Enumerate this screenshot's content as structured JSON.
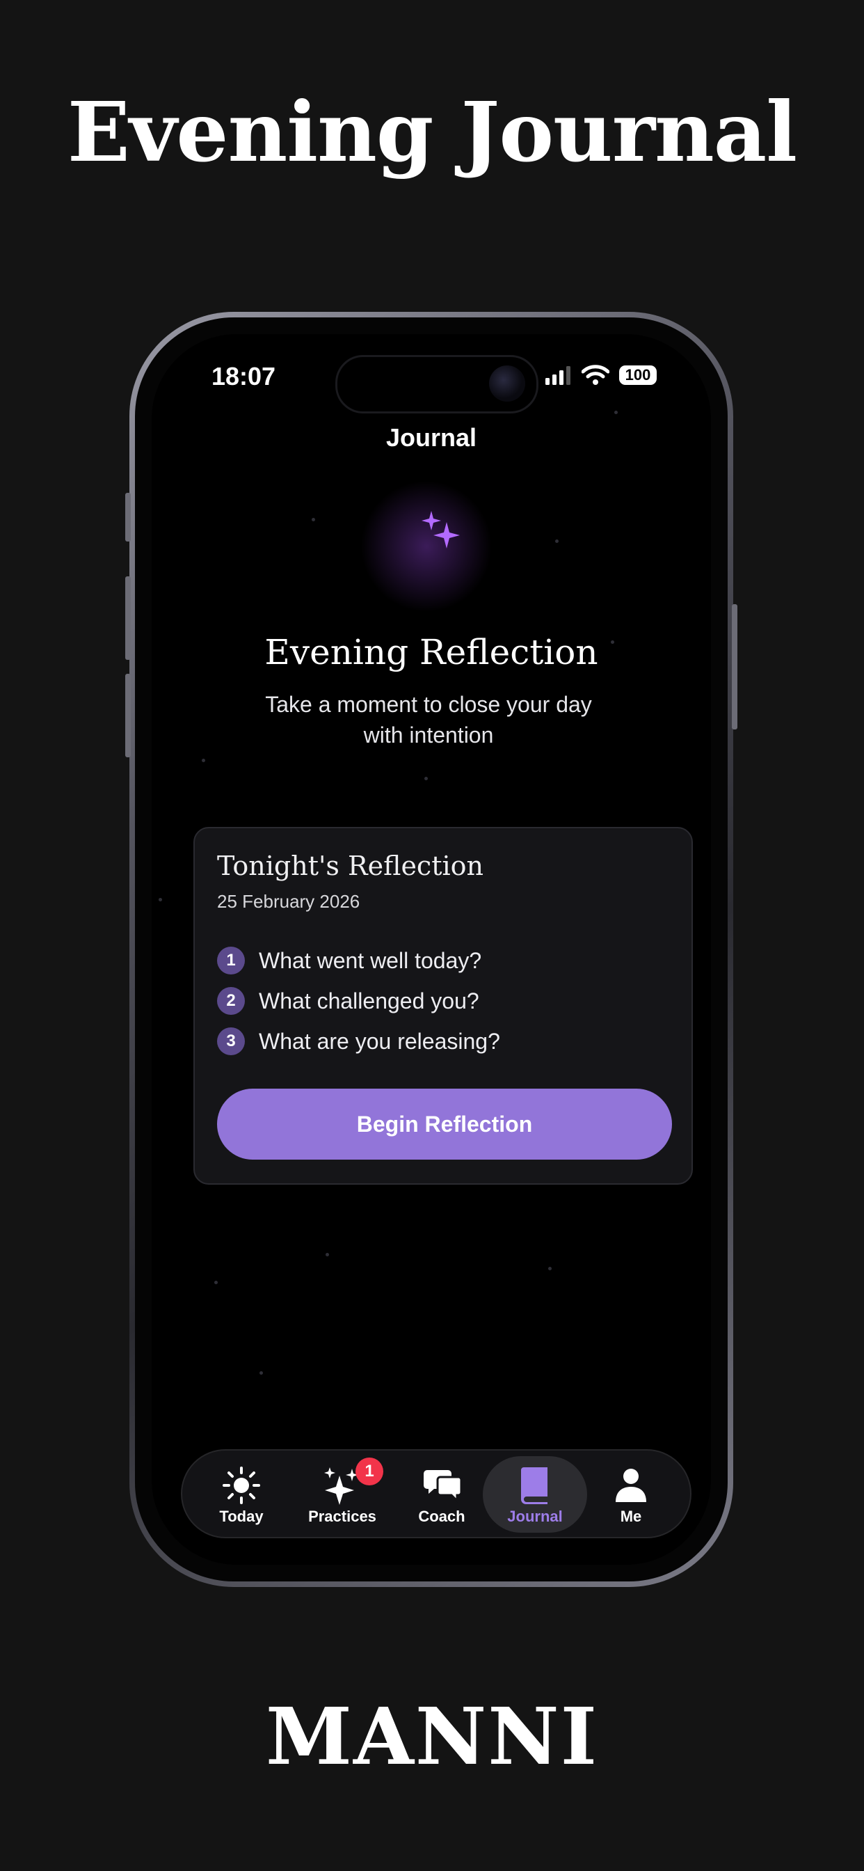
{
  "headline": "Evening Journal",
  "brand": "MANNI",
  "status": {
    "time": "18:07",
    "battery": "100"
  },
  "nav": {
    "title": "Journal"
  },
  "hero": {
    "icon": "moon-stars-icon",
    "title": "Evening Reflection",
    "subtitle_line1": "Take a moment to close your day",
    "subtitle_line2": "with intention"
  },
  "card": {
    "title": "Tonight's Reflection",
    "date": "25 February 2026",
    "prompts": [
      {
        "num": "1",
        "text": "What went well today?"
      },
      {
        "num": "2",
        "text": "What challenged you?"
      },
      {
        "num": "3",
        "text": "What are you releasing?"
      }
    ],
    "button_label": "Begin Reflection"
  },
  "tabs": [
    {
      "label": "Today",
      "icon": "sun-icon"
    },
    {
      "label": "Practices",
      "icon": "sparkles-icon",
      "badge": "1"
    },
    {
      "label": "Coach",
      "icon": "chat-bubbles-icon"
    },
    {
      "label": "Journal",
      "icon": "book-icon",
      "active": true
    },
    {
      "label": "Me",
      "icon": "person-icon"
    }
  ],
  "colors": {
    "accent": "#9275d9",
    "accent_text": "#9d7de8",
    "badge": "#f2344a",
    "background": "#141414"
  }
}
